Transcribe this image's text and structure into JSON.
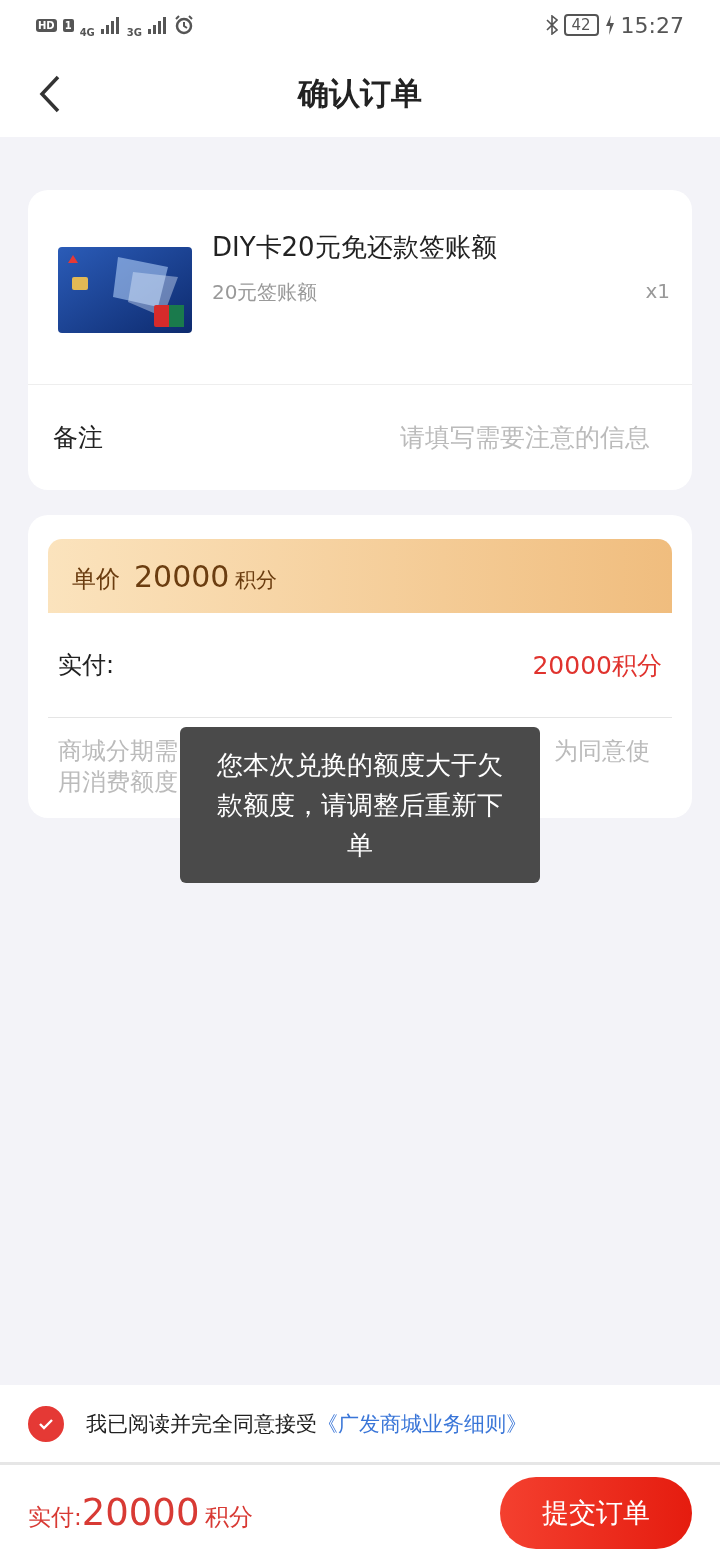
{
  "status_bar": {
    "hd": "HD",
    "sim": "1",
    "network_1": "4G",
    "network_2": "3G",
    "battery": "42",
    "time": "15:27"
  },
  "header": {
    "title": "确认订单"
  },
  "product": {
    "name": "DIY卡20元免还款签账额",
    "spec": "20元签账额",
    "quantity": "x1"
  },
  "remark": {
    "label": "备注",
    "placeholder": "请填写需要注意的信息"
  },
  "price": {
    "unit_label": "单价",
    "unit_value": "20000",
    "unit_suffix": "积分",
    "paid_label": "实付:",
    "paid_value": "20000积分"
  },
  "note": {
    "line1_start": "商城分期需",
    "line1_end": "为同意使",
    "line2": "用消费额度"
  },
  "toast": {
    "text": "您本次兑换的额度大于欠款额度，请调整后重新下单"
  },
  "agreement": {
    "checked": true,
    "text": "我已阅读并完全同意接受",
    "link": "《广发商城业务细则》"
  },
  "footer": {
    "label": "实付:",
    "amount": "20000",
    "unit": "积分",
    "submit": "提交订单"
  }
}
